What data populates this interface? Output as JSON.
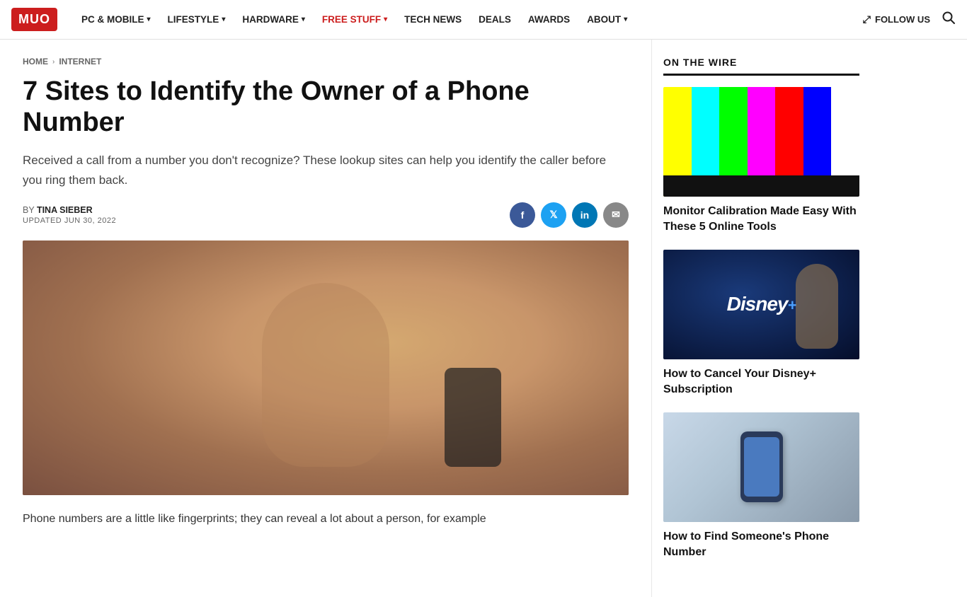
{
  "header": {
    "logo": "MUO",
    "nav": [
      {
        "label": "PC & MOBILE",
        "hasDropdown": true,
        "id": "pc-mobile"
      },
      {
        "label": "LIFESTYLE",
        "hasDropdown": true,
        "id": "lifestyle"
      },
      {
        "label": "HARDWARE",
        "hasDropdown": true,
        "id": "hardware"
      },
      {
        "label": "FREE STUFF",
        "hasDropdown": true,
        "id": "free-stuff",
        "highlight": true
      },
      {
        "label": "TECH NEWS",
        "hasDropdown": false,
        "id": "tech-news"
      },
      {
        "label": "DEALS",
        "hasDropdown": false,
        "id": "deals"
      },
      {
        "label": "AWARDS",
        "hasDropdown": false,
        "id": "awards"
      },
      {
        "label": "ABOUT",
        "hasDropdown": true,
        "id": "about"
      }
    ],
    "follow_us": "FOLLOW US",
    "search_aria": "Search"
  },
  "breadcrumb": {
    "home": "HOME",
    "section": "INTERNET"
  },
  "article": {
    "title": "7 Sites to Identify the Owner of a Phone Number",
    "subtitle": "Received a call from a number you don't recognize? These lookup sites can help you identify the caller before you ring them back.",
    "author_prefix": "BY",
    "author": "TINA SIEBER",
    "updated_prefix": "UPDATED",
    "updated_date": "JUN 30, 2022",
    "body_start": "Phone numbers are a little like fingerprints; they can reveal a lot about a person, for example",
    "social": {
      "facebook_aria": "Share on Facebook",
      "twitter_aria": "Share on Twitter",
      "linkedin_aria": "Share on LinkedIn",
      "email_aria": "Share via Email"
    }
  },
  "sidebar": {
    "section_title": "ON THE WIRE",
    "items": [
      {
        "title": "Monitor Calibration Made Easy With These 5 Online Tools",
        "image_type": "monitor-calibration",
        "color_bars": [
          "#ffff00",
          "#00ffff",
          "#00ff00",
          "#ff00ff",
          "#ff0000",
          "#0000ff",
          "#ffffff"
        ]
      },
      {
        "title": "How to Cancel Your Disney+ Subscription",
        "image_type": "disney-plus"
      },
      {
        "title": "How to Find Someone's Phone Number",
        "image_type": "phone-tech"
      }
    ]
  }
}
